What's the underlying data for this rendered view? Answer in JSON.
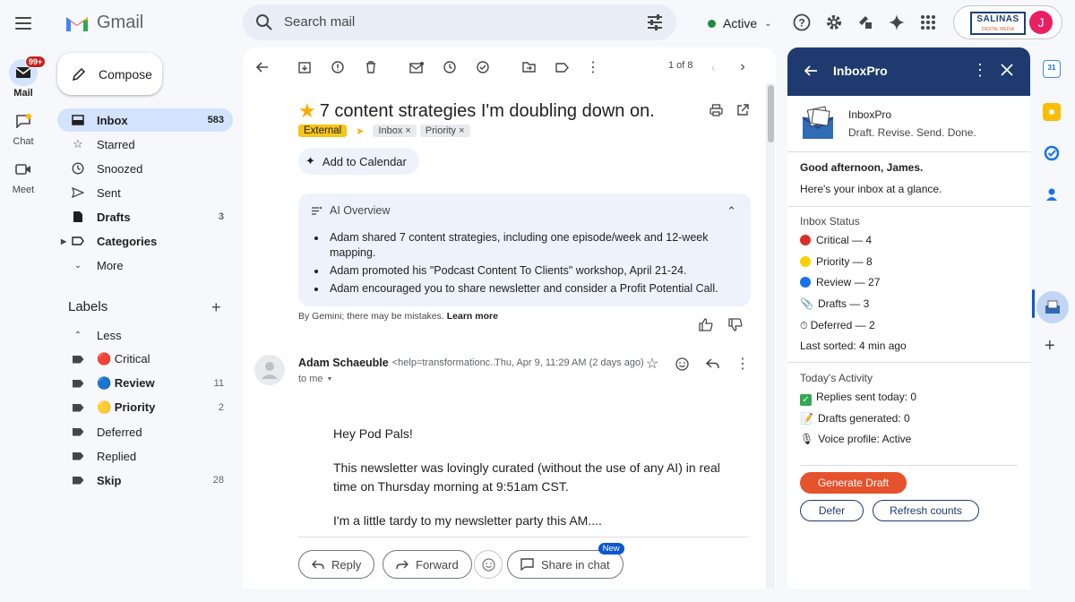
{
  "app": {
    "name": "Gmail"
  },
  "header": {
    "search_placeholder": "Search mail",
    "status": "Active",
    "brand_line1": "SALINAS",
    "brand_line2": "DIGITAL MEDIA",
    "avatar_letter": "J"
  },
  "rail": {
    "mail_label": "Mail",
    "mail_badge": "99+",
    "chat_label": "Chat",
    "meet_label": "Meet"
  },
  "sidebar": {
    "compose_label": "Compose",
    "items": [
      {
        "label": "Inbox",
        "count": "583"
      },
      {
        "label": "Starred",
        "count": ""
      },
      {
        "label": "Snoozed",
        "count": ""
      },
      {
        "label": "Sent",
        "count": ""
      },
      {
        "label": "Drafts",
        "count": "3"
      },
      {
        "label": "Categories",
        "count": ""
      },
      {
        "label": "More",
        "count": ""
      }
    ],
    "labels_header": "Labels",
    "labels": [
      {
        "label": "Less",
        "count": ""
      },
      {
        "label": "🔴 Critical",
        "count": ""
      },
      {
        "label": "🔵 Review",
        "count": "11"
      },
      {
        "label": "🟡 Priority",
        "count": "2"
      },
      {
        "label": "Deferred",
        "count": ""
      },
      {
        "label": "Replied",
        "count": ""
      },
      {
        "label": "Skip",
        "count": "28"
      }
    ]
  },
  "message": {
    "pager": "1 of 8",
    "subject": "7 content strategies I'm doubling down on.",
    "chip_external": "External",
    "chip_inbox": "Inbox ×",
    "chip_priority": "Priority ×",
    "add_calendar": "Add to Calendar",
    "ai_title": "AI Overview",
    "ai_points": [
      "Adam shared 7 content strategies, including one episode/week and 12-week mapping.",
      "Adam promoted his \"Podcast Content To Clients\" workshop, April 21-24.",
      "Adam encouraged you to share newsletter and consider a Profit Potential Call."
    ],
    "gemini_note": "By Gemini; there may be mistakes.",
    "learn_more": "Learn more",
    "sender_name": "Adam Schaeuble",
    "sender_email": "<help=transformationc...",
    "date": "Thu, Apr 9, 11:29 AM (2 days ago)",
    "to": "to me",
    "body": [
      "Hey Pod Pals!",
      "This newsletter was lovingly curated (without the use of any AI) in real time on Thursday morning at 9:51am CST.",
      "I'm a little tardy to my newsletter party this AM...."
    ],
    "reply": "Reply",
    "forward": "Forward",
    "share_chat": "Share in chat",
    "new_badge": "New"
  },
  "panel": {
    "title": "InboxPro",
    "app_name": "InboxPro",
    "tagline": "Draft. Revise. Send. Done.",
    "greeting": "Good afternoon, James.",
    "glance": "Here's your inbox at a glance.",
    "status_header": "Inbox Status",
    "critical": "Critical — 4",
    "priority": "Priority — 8",
    "review": "Review — 27",
    "drafts": "Drafts — 3",
    "deferred": "Deferred — 2",
    "last_sorted": "Last sorted: 4 min ago",
    "activity_header": "Today's Activity",
    "replies": "Replies sent today: 0",
    "drafts_gen": "Drafts generated: 0",
    "voice": "Voice profile: Active",
    "generate": "Generate Draft",
    "defer": "Defer",
    "refresh": "Refresh counts"
  },
  "colors": {
    "accent": "#0b57d0",
    "panel_header": "#1e3a6e",
    "generate_button": "#e6522c",
    "selected_nav": "#d3e3fd"
  }
}
